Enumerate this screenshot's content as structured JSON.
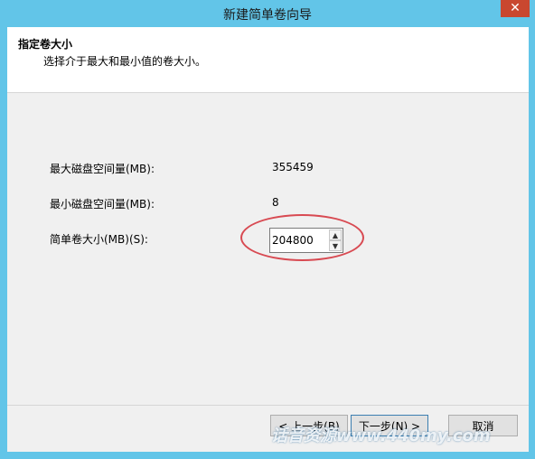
{
  "window": {
    "title": "新建简单卷向导",
    "close_glyph": "✕"
  },
  "header": {
    "title": "指定卷大小",
    "subtitle": "选择介于最大和最小值的卷大小。"
  },
  "fields": {
    "max_label": "最大磁盘空间量(MB):",
    "max_value": "355459",
    "min_label": "最小磁盘空间量(MB):",
    "min_value": "8",
    "size_label": "简单卷大小(MB)(S):",
    "size_value": "204800"
  },
  "buttons": {
    "back": "< 上一步(B)",
    "next": "下一步(N) >",
    "cancel": "取消"
  },
  "watermark": "话音资源www.440my.com",
  "colors": {
    "titlebar": "#62c5e8",
    "close_button": "#c9472f",
    "highlight_ellipse": "#d84a52"
  },
  "icons": {
    "close": "close-icon",
    "spin_up": "chevron-up-icon",
    "spin_down": "chevron-down-icon"
  }
}
